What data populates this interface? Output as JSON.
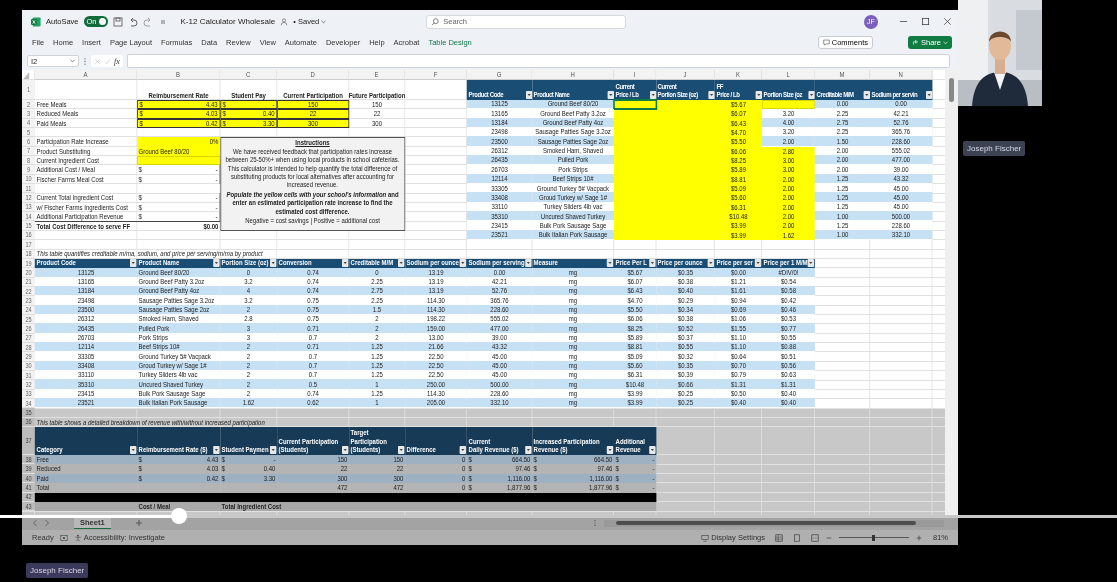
{
  "window": {
    "title": "K-12 Calculator Wholesale",
    "save_state": "• Saved",
    "autosave": {
      "label": "AutoSave",
      "on": true,
      "toggle_label": "On"
    },
    "search": {
      "placeholder": "Search"
    },
    "account_initials": "JF"
  },
  "menu": [
    {
      "label": "File",
      "contextual": false
    },
    {
      "label": "Home",
      "contextual": false
    },
    {
      "label": "Insert",
      "contextual": false
    },
    {
      "label": "Page Layout",
      "contextual": false
    },
    {
      "label": "Formulas",
      "contextual": false
    },
    {
      "label": "Data",
      "contextual": false
    },
    {
      "label": "Review",
      "contextual": false
    },
    {
      "label": "View",
      "contextual": false
    },
    {
      "label": "Automate",
      "contextual": false
    },
    {
      "label": "Developer",
      "contextual": false
    },
    {
      "label": "Help",
      "contextual": false
    },
    {
      "label": "Acrobat",
      "contextual": false
    },
    {
      "label": "Table Design",
      "contextual": true
    }
  ],
  "ribbon_buttons": {
    "comments": "Comments",
    "share": "Share"
  },
  "formula_bar": {
    "name_box": "I2",
    "function_label": "fx"
  },
  "column_letters": [
    "A",
    "B",
    "C",
    "D",
    "E",
    "F",
    "G",
    "H",
    "I",
    "J",
    "K",
    "L",
    "M",
    "N"
  ],
  "row_numbers": [
    "1",
    "2",
    "3",
    "4",
    "5",
    "6",
    "7",
    "8",
    "9",
    "10",
    "11",
    "12",
    "13",
    "14",
    "15",
    "16",
    "17",
    "18",
    "19",
    "20",
    "21",
    "22",
    "23",
    "24",
    "25",
    "26",
    "27",
    "28",
    "29",
    "30",
    "31",
    "32",
    "33",
    "34",
    "35",
    "36",
    "37",
    "38",
    "39",
    "40",
    "41",
    "42",
    "43"
  ],
  "meal_inputs": {
    "headers": [
      "Reimbursement Rate",
      "Student Pay",
      "Current Participation",
      "Future Participation"
    ],
    "rows": [
      {
        "label": "Free Meals",
        "rate": [
          "$",
          "4.43"
        ],
        "student_pay": [
          "$",
          "-"
        ],
        "current": "150",
        "future": "150"
      },
      {
        "label": "Reduced Meals",
        "rate": [
          "$",
          "4.03"
        ],
        "student_pay": [
          "$",
          "0.40"
        ],
        "current": "22",
        "future": "22"
      },
      {
        "label": "Paid Meals",
        "rate": [
          "$",
          "0.42"
        ],
        "student_pay": [
          "$",
          "3.30"
        ],
        "current": "300",
        "future": "300"
      }
    ]
  },
  "cost_inputs": [
    {
      "label": "Participation Rate Increase",
      "kind": "number",
      "value": "0%",
      "highlighted": true
    },
    {
      "label": "Product Substituting",
      "kind": "text",
      "value": "Ground Beef 80/20",
      "highlighted": true
    },
    {
      "label": "Current Ingredient Cost",
      "kind": "blank",
      "highlighted": true
    },
    {
      "label": "Additional Cost / Meal",
      "kind": "money",
      "value": [
        "$",
        "-"
      ],
      "highlighted": false
    },
    {
      "label": "Fischer Farms Meal Cost",
      "kind": "money",
      "value": [
        "$",
        "-"
      ],
      "highlighted": false
    }
  ],
  "cost_totals": [
    {
      "label": "Current Total Ingredient Cost",
      "kind": "money",
      "value": [
        "$",
        "-"
      ]
    },
    {
      "label": "w/ Fischer Farms Ingredients Cost",
      "kind": "money",
      "value": [
        "$",
        "-"
      ]
    },
    {
      "label": "Additional Participation Revenue",
      "kind": "money",
      "value": [
        "$",
        "-"
      ]
    },
    {
      "label": "Total Cost Difference to serve FF",
      "kind": "total",
      "value": "$0.00"
    }
  ],
  "instructions": {
    "title": "Instructions",
    "body": "We have received feedback that participation rates increase between 25-50%+ when using local products in school cafeterias. This calculator is intended to help quantify the total difference of substituting products for local alternatives after accounting for increased revenue.",
    "call_to_action": "*Populate the yellow cells with your school's information* and enter an estimated participation rate increase to find the estimated cost difference.",
    "legend": "Negative = cost savings | Positive = additional cost"
  },
  "products": {
    "headers": [
      "Product Code",
      "Product Name",
      "Current\nPrice / Lb",
      "Current\nPortion Size (oz)",
      "FF\nPrice / Lb",
      "Portion Size (oz",
      "Creditable M/M",
      "Sodium per servin"
    ],
    "rows": [
      {
        "code": "13125",
        "name": "Ground Beef 80/20",
        "ff_price": "$5.67",
        "portion_highlighted": true,
        "creditable": "0.00",
        "sodium": "0.00",
        "active_cell": true
      },
      {
        "code": "13165",
        "name": "Ground Beef Patty 3.2oz",
        "ff_price": "$6.07",
        "portion": "3.20",
        "portion_highlighted": false,
        "creditable": "2.25",
        "sodium": "42.21",
        "active_cell": false
      },
      {
        "code": "13184",
        "name": "Ground Beef Patty 4oz",
        "ff_price": "$6.43",
        "portion": "4.00",
        "portion_highlighted": false,
        "creditable": "2.75",
        "sodium": "52.76",
        "active_cell": false
      },
      {
        "code": "23498",
        "name": "Sausage Patties Sage 3.2oz",
        "ff_price": "$4.70",
        "portion": "3.20",
        "portion_highlighted": false,
        "creditable": "2.25",
        "sodium": "365.76",
        "active_cell": false
      },
      {
        "code": "23500",
        "name": "Sausage Patties Sage 2oz",
        "ff_price": "$5.50",
        "portion": "2.00",
        "portion_highlighted": false,
        "creditable": "1.50",
        "sodium": "228.60",
        "active_cell": false
      },
      {
        "code": "26312",
        "name": "Smoked Ham, Shaved",
        "ff_price": "$6.06",
        "portion": "2.80",
        "portion_highlighted": true,
        "creditable": "2.00",
        "sodium": "555.02",
        "active_cell": false
      },
      {
        "code": "26435",
        "name": "Pulled Pork",
        "ff_price": "$8.25",
        "portion": "3.00",
        "portion_highlighted": true,
        "creditable": "2.00",
        "sodium": "477.00",
        "active_cell": false
      },
      {
        "code": "26703",
        "name": "Pork Strips",
        "ff_price": "$5.89",
        "portion": "3.00",
        "portion_highlighted": true,
        "creditable": "2.00",
        "sodium": "39.00",
        "active_cell": false
      },
      {
        "code": "12114",
        "name": "Beef Strips 10#",
        "ff_price": "$8.81",
        "portion": "2.00",
        "portion_highlighted": true,
        "creditable": "1.25",
        "sodium": "43.32",
        "active_cell": false
      },
      {
        "code": "33305",
        "name": "Ground Turkey 5# Vacpack",
        "ff_price": "$5.09",
        "portion": "2.00",
        "portion_highlighted": true,
        "creditable": "1.25",
        "sodium": "45.00",
        "active_cell": false
      },
      {
        "code": "33408",
        "name": "Groud Turkey w/ Sage 1#",
        "ff_price": "$5.60",
        "portion": "2.00",
        "portion_highlighted": true,
        "creditable": "1.25",
        "sodium": "45.00",
        "active_cell": false
      },
      {
        "code": "33110",
        "name": "Turkey Sliders 4lb vac",
        "ff_price": "$6.31",
        "portion": "2.00",
        "portion_highlighted": true,
        "creditable": "1.25",
        "sodium": "45.00",
        "active_cell": false
      },
      {
        "code": "35310",
        "name": "Uncured Shaved Turkey",
        "ff_price": "$10.48",
        "portion": "2.00",
        "portion_highlighted": true,
        "creditable": "1.00",
        "sodium": "500.00",
        "active_cell": false
      },
      {
        "code": "23415",
        "name": "Bulk Pork Sausage Sage",
        "ff_price": "$3.99",
        "portion": "2.00",
        "portion_highlighted": true,
        "creditable": "1.25",
        "sodium": "228.60",
        "active_cell": false
      },
      {
        "code": "23521",
        "name": "Bulk Italian Pork Sausage",
        "ff_price": "$3.99",
        "portion": "1.62",
        "portion_highlighted": true,
        "creditable": "1.00",
        "sodium": "332.10",
        "active_cell": false
      }
    ]
  },
  "conversion": {
    "note": "This table quantifies creditable m/ma, sodium, and price per serving/m/ma by product",
    "headers": [
      "Product Code",
      "Product Name",
      "Portion Size (oz)",
      "Conversion",
      "Creditable M/M",
      "Sodium per ounce",
      "Sodium per serving",
      "Measure",
      "Price Per L",
      "Price per ounce",
      "Price per ser",
      "Price per 1 M/M"
    ],
    "rows": [
      [
        "13125",
        "Ground Beef 80/20",
        "0",
        "0.74",
        "0",
        "13.19",
        "0.00",
        "mg",
        "$5.67",
        "$0.35",
        "$0.00",
        "#DIV/0!"
      ],
      [
        "13165",
        "Ground Beef Patty 3.2oz",
        "3.2",
        "0.74",
        "2.25",
        "13.19",
        "42.21",
        "mg",
        "$6.07",
        "$0.38",
        "$1.21",
        "$0.54"
      ],
      [
        "13184",
        "Ground Beef Patty 4oz",
        "4",
        "0.74",
        "2.75",
        "13.19",
        "52.76",
        "mg",
        "$6.43",
        "$0.40",
        "$1.61",
        "$0.58"
      ],
      [
        "23498",
        "Sausage Patties Sage 3.2oz",
        "3.2",
        "0.75",
        "2.25",
        "114.30",
        "365.76",
        "mg",
        "$4.70",
        "$0.29",
        "$0.94",
        "$0.42"
      ],
      [
        "23500",
        "Sausage Patties Sage 2oz",
        "2",
        "0.75",
        "1.5",
        "114.30",
        "228.60",
        "mg",
        "$5.50",
        "$0.34",
        "$0.69",
        "$0.46"
      ],
      [
        "26312",
        "Smoked Ham, Shaved",
        "2.8",
        "0.75",
        "2",
        "198.22",
        "555.02",
        "mg",
        "$6.06",
        "$0.38",
        "$1.06",
        "$0.53"
      ],
      [
        "26435",
        "Pulled Pork",
        "3",
        "0.71",
        "2",
        "159.00",
        "477.00",
        "mg",
        "$8.25",
        "$0.52",
        "$1.55",
        "$0.77"
      ],
      [
        "26703",
        "Pork Strips",
        "3",
        "0.7",
        "2",
        "13.00",
        "39.00",
        "mg",
        "$5.89",
        "$0.37",
        "$1.10",
        "$0.55"
      ],
      [
        "12114",
        "Beef Strips 10#",
        "2",
        "0.71",
        "1.25",
        "21.66",
        "43.32",
        "mg",
        "$8.81",
        "$0.55",
        "$1.10",
        "$0.88"
      ],
      [
        "33305",
        "Ground Turkey 5# Vacpack",
        "2",
        "0.7",
        "1.25",
        "22.50",
        "45.00",
        "mg",
        "$5.09",
        "$0.32",
        "$0.64",
        "$0.51"
      ],
      [
        "33408",
        "Groud Turkey w/ Sage 1#",
        "2",
        "0.7",
        "1.25",
        "22.50",
        "45.00",
        "mg",
        "$5.60",
        "$0.35",
        "$0.70",
        "$0.56"
      ],
      [
        "33110",
        "Turkey Sliders 4lb vac",
        "2",
        "0.7",
        "1.25",
        "22.50",
        "45.00",
        "mg",
        "$6.31",
        "$0.39",
        "$0.79",
        "$0.63"
      ],
      [
        "35310",
        "Uncured Shaved Turkey",
        "2",
        "0.5",
        "1",
        "250.00",
        "500.00",
        "mg",
        "$10.48",
        "$0.66",
        "$1.31",
        "$1.31"
      ],
      [
        "23415",
        "Bulk Pork Sausage Sage",
        "2",
        "0.74",
        "1.25",
        "114.30",
        "228.60",
        "mg",
        "$3.99",
        "$0.25",
        "$0.50",
        "$0.40"
      ],
      [
        "23521",
        "Bulk Italian Pork Sausage",
        "1.62",
        "0.62",
        "1",
        "205.00",
        "332.10",
        "mg",
        "$3.99",
        "$0.25",
        "$0.40",
        "$0.40"
      ]
    ]
  },
  "revenue": {
    "note": "This table shows a detailed breakdown of revenue with/without increased participation",
    "headers": [
      "Category",
      "Reimbursement Rate ($)",
      "Student Paymen",
      "Current Participation\n(Students)",
      "Target\nParticipation\n(Students)",
      "Difference",
      "Current\nDaily Revenue ($)",
      "Increased Participation\nRevenue ($)",
      "Additional\nRevenue"
    ],
    "rows": [
      {
        "category": "Free",
        "rate": [
          "$",
          "4.43"
        ],
        "student_payment": [
          "$",
          "-"
        ],
        "current": "150",
        "target": "150",
        "difference": "0",
        "current_revenue": [
          "$",
          "664.50"
        ],
        "increased_revenue": [
          "$",
          "664.50"
        ],
        "additional_revenue": [
          "$",
          "-"
        ]
      },
      {
        "category": "Reduced",
        "rate": [
          "$",
          "4.03"
        ],
        "student_payment": [
          "$",
          "0.40"
        ],
        "current": "22",
        "target": "22",
        "difference": "0",
        "current_revenue": [
          "$",
          "97.46"
        ],
        "increased_revenue": [
          "$",
          "97.46"
        ],
        "additional_revenue": [
          "$",
          "-"
        ]
      },
      {
        "category": "Paid",
        "rate": [
          "$",
          "0.42"
        ],
        "student_payment": [
          "$",
          "3.30"
        ],
        "current": "300",
        "target": "300",
        "difference": "0",
        "current_revenue": [
          "$",
          "1,116.00"
        ],
        "increased_revenue": [
          "$",
          "1,116.00"
        ],
        "additional_revenue": [
          "$",
          "-"
        ]
      },
      {
        "category": "Total",
        "current": "472",
        "target": "472",
        "difference": "0",
        "current_revenue": [
          "$",
          "1,877.96"
        ],
        "increased_revenue": [
          "$",
          "1,877.96"
        ],
        "additional_revenue": [
          "$",
          "-"
        ]
      }
    ],
    "footer_labels": [
      "Cost / Meal",
      "Total Ingredient Cost"
    ]
  },
  "sheet_tabs": [
    {
      "label": "Sheet1",
      "selected": true
    }
  ],
  "status_bar": {
    "ready": "Ready",
    "accessibility": "Accessibility: Investigate",
    "display_settings": "Display Settings",
    "zoom": "81%",
    "zoom_slider": {
      "level": 0.5
    }
  },
  "video": {
    "progress": {
      "level": 0.16
    },
    "participant_label": "Joseph Fischer",
    "speaker_label": "Joseph Fischer"
  }
}
